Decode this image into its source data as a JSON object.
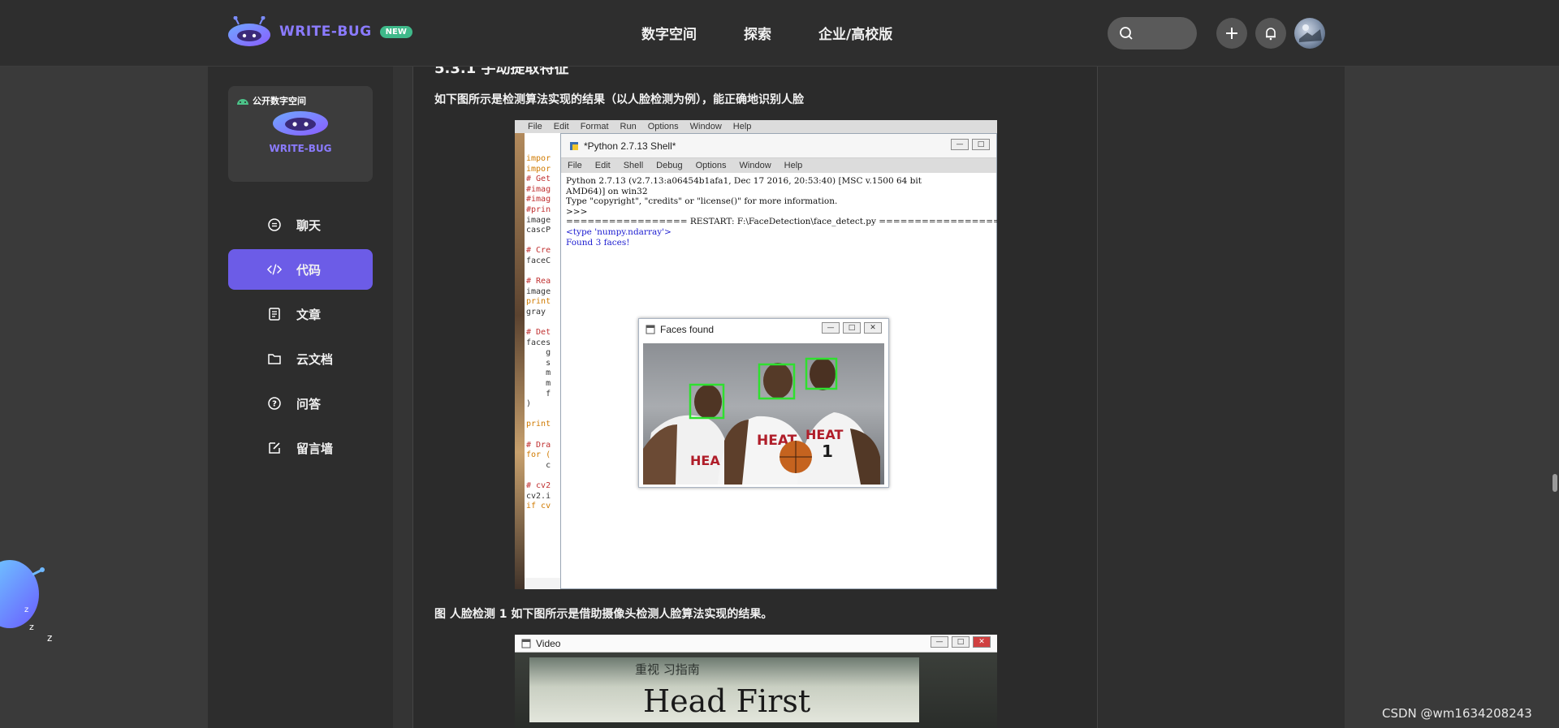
{
  "header": {
    "logo_text": "WRITE-BUG",
    "new_badge": "NEW",
    "nav": [
      "数字空间",
      "探索",
      "企业/高校版"
    ]
  },
  "sidebar": {
    "space_card": {
      "badge": "公开数字空间",
      "name": "WRITE-BUG"
    },
    "items": [
      {
        "label": "聊天",
        "icon": "chat-icon",
        "active": false
      },
      {
        "label": "代码",
        "icon": "code-icon",
        "active": true
      },
      {
        "label": "文章",
        "icon": "article-icon",
        "active": false
      },
      {
        "label": "云文档",
        "icon": "folder-icon",
        "active": false
      },
      {
        "label": "问答",
        "icon": "question-icon",
        "active": false
      },
      {
        "label": "留言墙",
        "icon": "edit-icon",
        "active": false
      }
    ]
  },
  "article": {
    "section_heading": "5.3.1 手动提取特征",
    "para1": "如下图所示是检测算法实现的结果（以人脸检测为例），能正确地识别人脸",
    "para2": "图 人脸检测 1 如下图所示是借助摄像头检测人脸算法实现的结果。"
  },
  "figure1": {
    "editor_menu": [
      "File",
      "Edit",
      "Format",
      "Run",
      "Options",
      "Window",
      "Help"
    ],
    "editor_lines": [
      "impor",
      "impor",
      "# Get",
      "#imag",
      "#imag",
      "#prin",
      "image",
      "cascP",
      "",
      "# Cre",
      "faceC",
      "",
      "# Rea",
      "image",
      "print",
      "gray ",
      "",
      "# Det",
      "faces",
      "    g",
      "    s",
      "    m",
      "    m",
      "    f",
      ")",
      "",
      "print",
      "",
      "# Dra",
      "for (",
      "    c",
      "",
      "# cv2",
      "cv2.i",
      "if cv"
    ],
    "shell_title": "*Python 2.7.13 Shell*",
    "shell_menu": [
      "File",
      "Edit",
      "Shell",
      "Debug",
      "Options",
      "Window",
      "Help"
    ],
    "shell_lines": [
      "Python 2.7.13 (v2.7.13:a06454b1afa1, Dec 17 2016, 20:53:40) [MSC v.1500 64 bit",
      "AMD64)] on win32",
      "Type \"copyright\", \"credits\" or \"license()\" for more information.",
      ">>> ",
      "================= RESTART: F:\\FaceDetection\\face_detect.py =================="
    ],
    "shell_output": [
      "<type 'numpy.ndarray'>",
      "Found 3 faces!"
    ],
    "faces_window_title": "Faces found"
  },
  "figure2": {
    "window_title": "Video",
    "book_cn": "重视        习指南",
    "book_en": "Head First"
  },
  "watermark": "CSDN @wm1634208243",
  "colors": {
    "accent": "#6c5ce7",
    "logo": "#8b7bff",
    "badge": "#3fb98a"
  }
}
